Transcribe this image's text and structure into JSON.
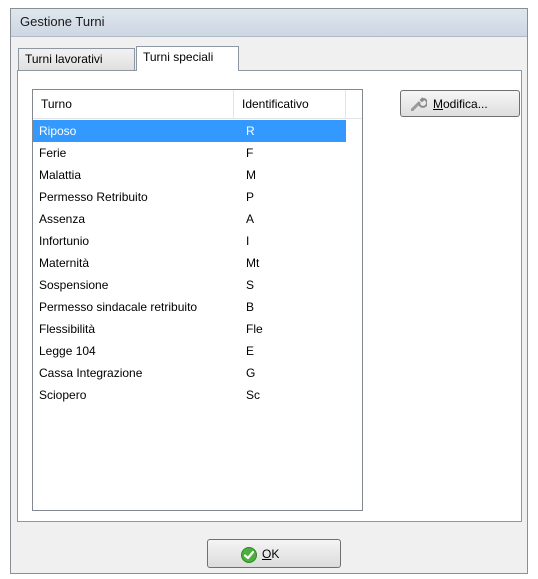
{
  "window": {
    "title": "Gestione Turni"
  },
  "tabs": [
    {
      "label": "Turni lavorativi",
      "active": false
    },
    {
      "label": "Turni speciali",
      "active": true
    }
  ],
  "list": {
    "columns": [
      "Turno",
      "Identificativo"
    ],
    "rows": [
      {
        "name": "Riposo",
        "code": "R",
        "selected": true
      },
      {
        "name": "Ferie",
        "code": "F"
      },
      {
        "name": "Malattia",
        "code": "M"
      },
      {
        "name": "Permesso Retribuito",
        "code": "P"
      },
      {
        "name": "Assenza",
        "code": "A"
      },
      {
        "name": "Infortunio",
        "code": "I"
      },
      {
        "name": "Maternità",
        "code": "Mt"
      },
      {
        "name": "Sospensione",
        "code": "S"
      },
      {
        "name": "Permesso sindacale retribuito",
        "code": "B"
      },
      {
        "name": "Flessibilità",
        "code": "Fle"
      },
      {
        "name": "Legge 104",
        "code": "E"
      },
      {
        "name": "Cassa Integrazione",
        "code": "G"
      },
      {
        "name": "Sciopero",
        "code": "Sc"
      }
    ]
  },
  "buttons": {
    "modifica": {
      "label": "Modifica...",
      "icon": "wrench-icon"
    },
    "ok": {
      "label": "OK",
      "icon": "check-icon"
    }
  },
  "colors": {
    "selection": "#3399ff",
    "ok_icon": "#3aa33a"
  }
}
